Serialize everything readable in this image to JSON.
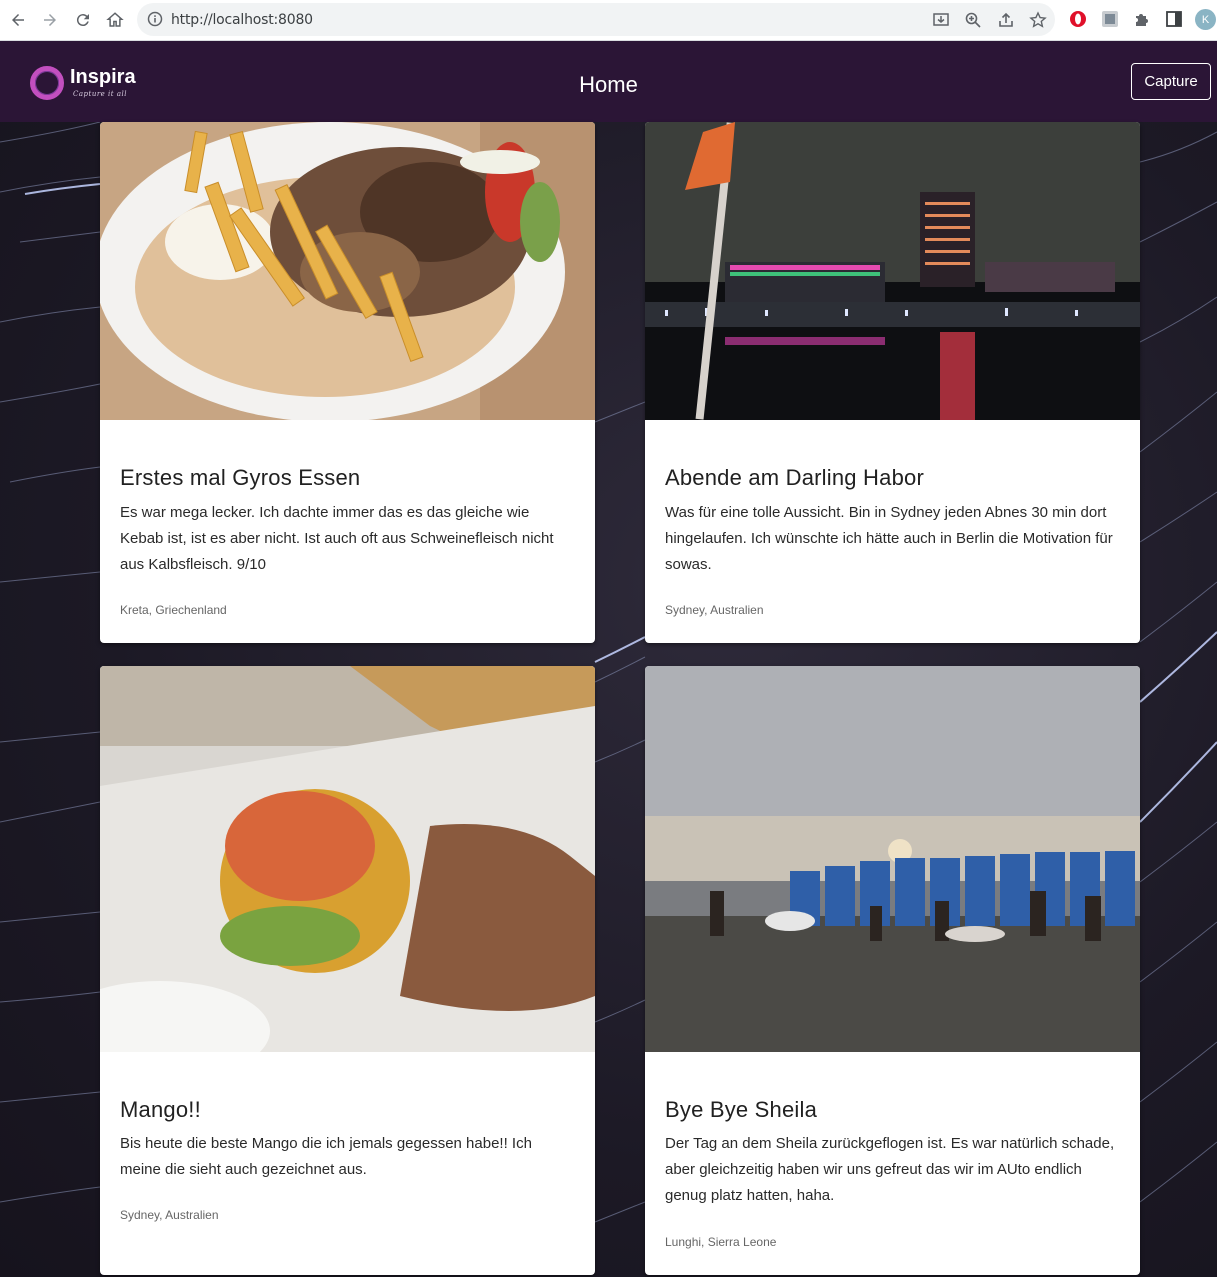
{
  "browser": {
    "url": "http://localhost:8080",
    "profile_initial": "K"
  },
  "app": {
    "logo_name": "Inspira",
    "logo_tagline": "Capture it all",
    "page_title": "Home",
    "capture_label": "Capture"
  },
  "posts": [
    {
      "title": "Erstes mal Gyros Essen",
      "text": "Es war mega lecker. Ich dachte immer das es das gleiche wie Kebab ist, ist es aber nicht. Ist auch oft aus Schweinefleisch nicht aus Kalbsfleisch. 9/10",
      "location": "Kreta, Griechenland"
    },
    {
      "title": "Abende am Darling Habor",
      "text": "Was für eine tolle Aussicht. Bin in Sydney jeden Abnes 30 min dort hingelaufen. Ich wünschte ich hätte auch in Berlin die Motivation für sowas.",
      "location": "Sydney, Australien"
    },
    {
      "title": "Mango!!",
      "text": "Bis heute die beste Mango die ich jemals gegessen habe!! Ich meine die sieht auch gezeichnet aus.",
      "location": "Sydney, Australien"
    },
    {
      "title": "Bye Bye Sheila",
      "text": "Der Tag an dem Sheila zurückgeflogen ist. Es war natürlich schade, aber gleichzeitig haben wir uns gefreut das wir im AUto endlich genug platz hatten, haha.",
      "location": "Lunghi, Sierra Leone"
    }
  ]
}
